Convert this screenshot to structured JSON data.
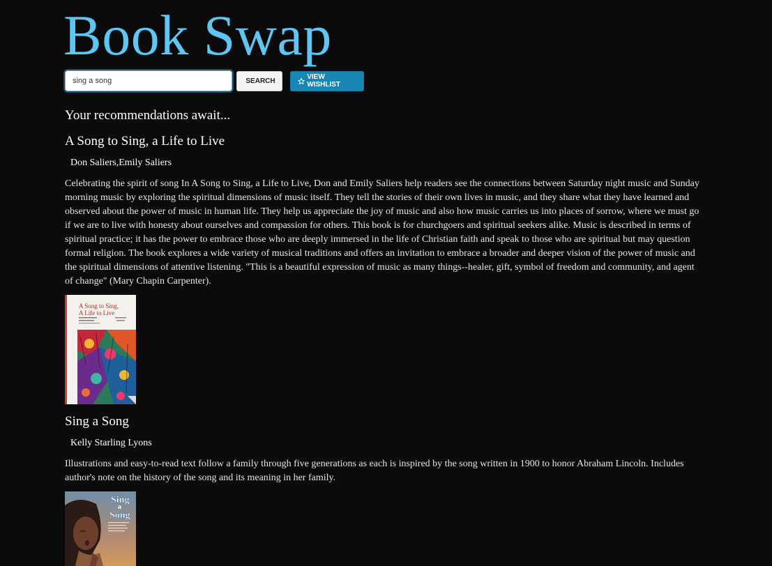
{
  "app": {
    "title": "Book Swap"
  },
  "search": {
    "value": "sing a song",
    "button_label": "Search",
    "wishlist_label": "View Wishlist"
  },
  "recommendations": {
    "heading": "Your recommendations await...",
    "books": [
      {
        "title": "A Song to Sing, a Life to Live",
        "authors": "Don Saliers,Emily Saliers",
        "description": "Celebrating the spirit of song In A Song to Sing, a Life to Live, Don and Emily Saliers help readers see the connections between Saturday night music and Sunday morning music by exploring the spiritual dimensions of music itself. They tell the stories of their own lives in music, and they share what they have learned and observed about the power of music in human life. They help us appreciate the joy of music and also how music carries us into places of sorrow, where we must go if we are to live with honesty about ourselves and compassion for others. This book is for churchgoers and spiritual seekers alike. Music is described in terms of spiritual practice; it has the power to embrace those who are deeply immersed in the life of Christian faith and speak to those who are spiritual but may question formal religion. The book explores a wide variety of musical traditions and offers an invitation to embrace a broader and deeper vision of the power of music and the spiritual dimensions of attentive listening. \"This is a beautiful expression of music as many things--healer, gift, symbol of freedom and community, and agent of change\" (Mary Chapin Carpenter).",
        "cover_text": [
          "A Song to Sing,",
          "A Life to Live"
        ]
      },
      {
        "title": "Sing a Song",
        "authors": "Kelly Starling Lyons",
        "description": "Illustrations and easy-to-read text follow a family through five generations as each is inspired by the song written in 1900 to honor Abraham Lincoln. Includes author's note on the history of the song and its meaning in her family.",
        "cover_text": [
          "Sing",
          "a",
          "Song"
        ]
      }
    ]
  },
  "colors": {
    "background": "#0b0b0b",
    "title": "#5fc6f3",
    "wishlist_button": "#1a86b3"
  },
  "icons": {
    "search": "search-icon",
    "wishlist": "star-icon"
  }
}
